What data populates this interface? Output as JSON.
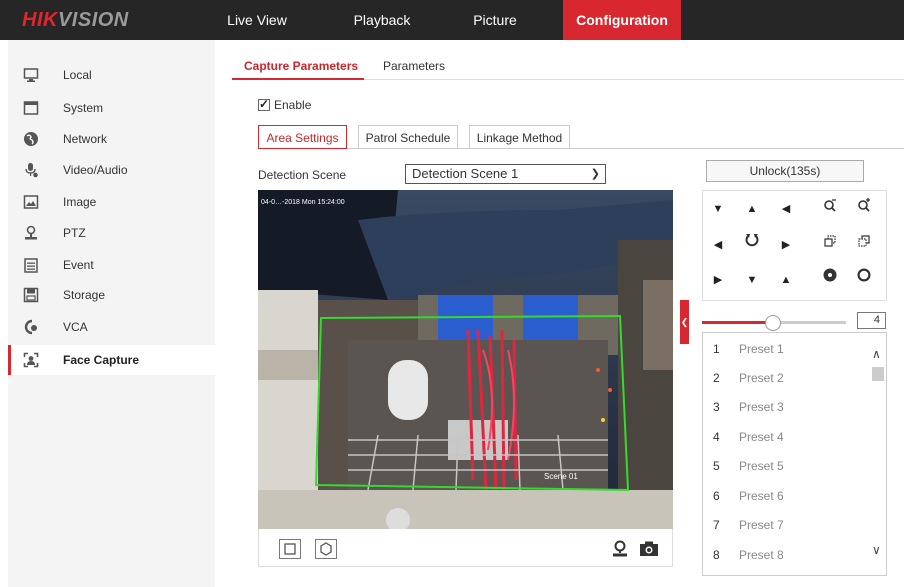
{
  "header": {
    "logo_part1": "HIK",
    "logo_part2": "VISION",
    "nav": [
      {
        "label": "Live View"
      },
      {
        "label": "Playback"
      },
      {
        "label": "Picture"
      },
      {
        "label": "Configuration"
      }
    ]
  },
  "sidebar": {
    "items": [
      {
        "label": "Local",
        "icon": "monitor-icon"
      },
      {
        "label": "System",
        "icon": "window-icon"
      },
      {
        "label": "Network",
        "icon": "globe-icon"
      },
      {
        "label": "Video/Audio",
        "icon": "microphone-icon"
      },
      {
        "label": "Image",
        "icon": "image-icon"
      },
      {
        "label": "PTZ",
        "icon": "ptz-icon"
      },
      {
        "label": "Event",
        "icon": "calendar-icon"
      },
      {
        "label": "Storage",
        "icon": "storage-icon"
      },
      {
        "label": "VCA",
        "icon": "vca-icon"
      },
      {
        "label": "Face Capture",
        "icon": "face-capture-icon"
      }
    ]
  },
  "subtabs": [
    {
      "label": "Capture Parameters"
    },
    {
      "label": "Parameters"
    }
  ],
  "enable_label": "Enable",
  "steps": [
    {
      "label": "Area Settings"
    },
    {
      "label": "Patrol Schedule"
    },
    {
      "label": "Linkage Method"
    }
  ],
  "detection": {
    "label": "Detection Scene",
    "value": "Detection Scene 1"
  },
  "video": {
    "timestamp": "04-0…-2018 Mon 15:24:00",
    "scene_label": "Scene 01"
  },
  "ptz": {
    "unlock_label": "Unlock(135s)",
    "speed_value": "4",
    "speed_fraction": 0.49
  },
  "presets": [
    {
      "num": "1",
      "name": "Preset 1"
    },
    {
      "num": "2",
      "name": "Preset 2"
    },
    {
      "num": "3",
      "name": "Preset 3"
    },
    {
      "num": "4",
      "name": "Preset 4"
    },
    {
      "num": "5",
      "name": "Preset 5"
    },
    {
      "num": "6",
      "name": "Preset 6"
    },
    {
      "num": "7",
      "name": "Preset 7"
    },
    {
      "num": "8",
      "name": "Preset 8"
    }
  ],
  "colors": {
    "accent": "#d8272f",
    "topbar": "#262626",
    "detection_box": "#35d92f"
  }
}
